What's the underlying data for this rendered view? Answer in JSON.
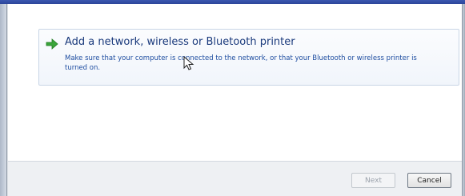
{
  "option": {
    "title": "Add a network, wireless or Bluetooth printer",
    "description": "Make sure that your computer is connected to the network, or that your Bluetooth or wireless printer is turned on.",
    "icon": "green-arrow-icon"
  },
  "footer": {
    "next_label": "Next",
    "cancel_label": "Cancel"
  },
  "colors": {
    "title_bar": "#2c449a",
    "option_title": "#1a3a7c",
    "option_desc": "#1e4da0",
    "arrow": "#3aa53a"
  }
}
